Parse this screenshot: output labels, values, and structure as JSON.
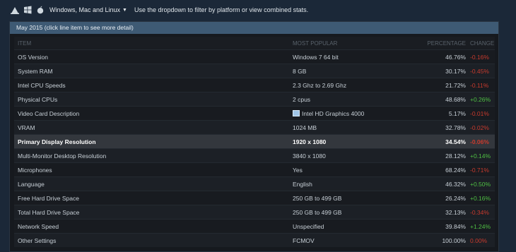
{
  "topbar": {
    "icons": [
      "steam-icon",
      "windows-icon",
      "apple-icon"
    ],
    "platform_filter": "Windows, Mac and Linux",
    "hint": "Use the dropdown to filter by platform or view combined stats."
  },
  "panel": {
    "header": "May 2015 (click line item to see more detail)",
    "columns": {
      "item": "ITEM",
      "popular": "MOST POPULAR",
      "percentage": "PERCENTAGE",
      "change": "CHANGE"
    },
    "rows": [
      {
        "item": "OS Version",
        "popular": "Windows 7 64 bit",
        "pct": "46.76%",
        "change": "-0.16%",
        "dir": "neg"
      },
      {
        "item": "System RAM",
        "popular": "8 GB",
        "pct": "30.17%",
        "change": "-0.45%",
        "dir": "neg"
      },
      {
        "item": "Intel CPU Speeds",
        "popular": "2.3 Ghz to 2.69 Ghz",
        "pct": "21.72%",
        "change": "-0.11%",
        "dir": "neg"
      },
      {
        "item": "Physical CPUs",
        "popular": "2 cpus",
        "pct": "48.68%",
        "change": "+0.26%",
        "dir": "pos"
      },
      {
        "item": "Video Card Description",
        "popular": "Intel HD Graphics 4000",
        "pct": "5.17%",
        "change": "-0.01%",
        "dir": "neg",
        "icon": "gpu-icon"
      },
      {
        "item": "VRAM",
        "popular": "1024 MB",
        "pct": "32.78%",
        "change": "-0.02%",
        "dir": "neg"
      },
      {
        "item": "Primary Display Resolution",
        "popular": "1920 x 1080",
        "pct": "34.54%",
        "change": "-0.06%",
        "dir": "neg",
        "highlight": true
      },
      {
        "item": "Multi-Monitor Desktop Resolution",
        "popular": "3840 x 1080",
        "pct": "28.12%",
        "change": "+0.14%",
        "dir": "pos"
      },
      {
        "item": "Microphones",
        "popular": "Yes",
        "pct": "68.24%",
        "change": "-0.71%",
        "dir": "neg"
      },
      {
        "item": "Language",
        "popular": "English",
        "pct": "46.32%",
        "change": "+0.50%",
        "dir": "pos"
      },
      {
        "item": "Free Hard Drive Space",
        "popular": "250 GB to 499 GB",
        "pct": "26.24%",
        "change": "+0.16%",
        "dir": "pos"
      },
      {
        "item": "Total Hard Drive Space",
        "popular": "250 GB to 499 GB",
        "pct": "32.13%",
        "change": "-0.34%",
        "dir": "neg"
      },
      {
        "item": "Network Speed",
        "popular": "Unspecified",
        "pct": "39.84%",
        "change": "+1.24%",
        "dir": "pos"
      },
      {
        "item": "Other Settings",
        "popular": "FCMOV",
        "pct": "100.00%",
        "change": "0.00%",
        "dir": "neg"
      }
    ]
  }
}
